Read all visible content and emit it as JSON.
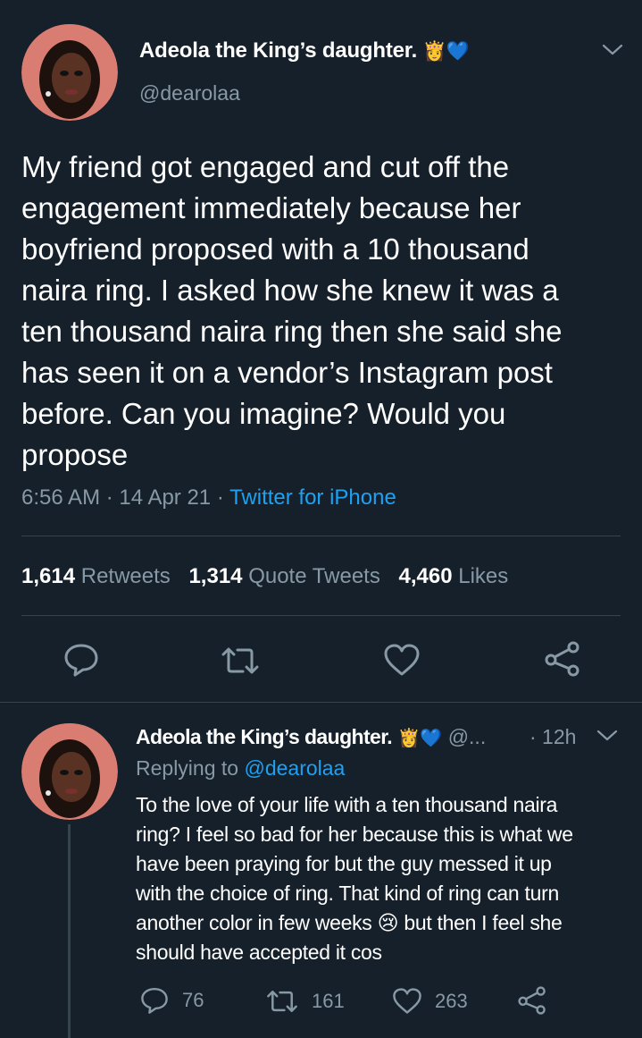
{
  "tweet": {
    "author_name": "Adeola the King’s daughter.",
    "author_emoji": "👸💙",
    "handle": "@dearolaa",
    "text_lines": [
      "My friend got engaged and cut off the",
      "engagement immediately because her",
      "boyfriend proposed with a 10 thousand",
      "naira ring. I asked how she knew it was a",
      "ten thousand naira ring then she said she",
      "has seen it on a vendor’s Instagram post",
      "before. Can you imagine? Would you",
      "propose"
    ],
    "time": "6:56 AM",
    "dot1": "·",
    "date": "14 Apr 21",
    "dot2": "·",
    "source": "Twitter for iPhone",
    "retweets_count": "1,614",
    "retweets_label": "Retweets",
    "quotes_count": "1,314",
    "quotes_label": "Quote Tweets",
    "likes_count": "4,460",
    "likes_label": "Likes"
  },
  "reply": {
    "author_name": "Adeola the King’s daughter.",
    "author_emoji": "👸💙",
    "handle_trunc": "@...",
    "time": "· 12h",
    "replying_prefix": "Replying to",
    "replying_handle": "@dearolaa",
    "text_lines": [
      "To the love of your life with a ten thousand naira",
      "ring? I feel so bad for her because this is what we",
      "have been praying for but the guy messed it up",
      "with the choice of ring. That kind of ring can turn",
      "another color in few weeks 😢 but then I feel she",
      "should have accepted it cos"
    ],
    "reply_count": "76",
    "retweet_count": "161",
    "like_count": "263"
  },
  "colors": {
    "background": "#15202b",
    "muted": "#8899a6",
    "accent": "#1da1f2",
    "divider": "#38444d"
  },
  "icons": [
    "reply-icon",
    "retweet-icon",
    "like-icon",
    "share-icon",
    "chevron-down-icon"
  ]
}
